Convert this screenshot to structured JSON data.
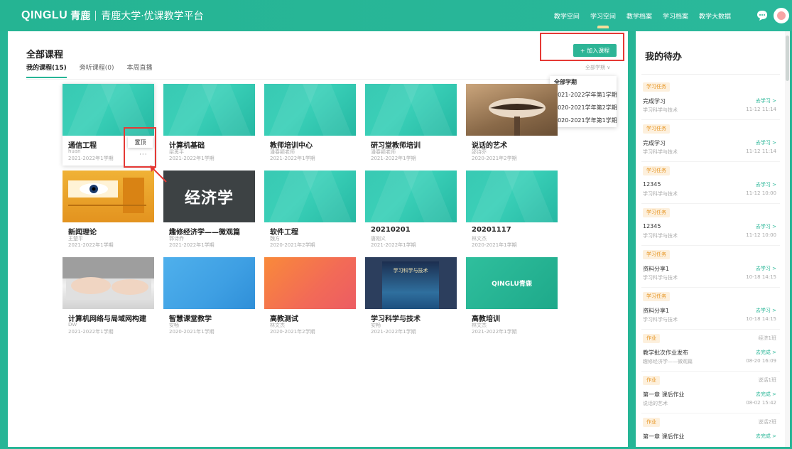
{
  "header": {
    "logo_en": "QINGLU",
    "logo_cn": "青鹿",
    "platform": "青鹿大学·优课教学平台",
    "nav": [
      "教学空间",
      "学习空间",
      "教学档案",
      "学习档案",
      "教学大数据"
    ],
    "active_nav": "学习空间"
  },
  "main": {
    "title": "全部课程",
    "tabs": [
      "我的课程(15)",
      "旁听课程(0)",
      "本周直播"
    ],
    "join_button": "+ 加入课程",
    "term_select": "全部学期 ∨",
    "term_options": [
      "全部学期",
      "2021-2022学年第1学期",
      "2020-2021学年第2学期",
      "2020-2021学年第1学期"
    ],
    "pin_label": "置顶",
    "more_label": "···",
    "courses": [
      {
        "title": "通信工程",
        "teacher": "huan",
        "term": "2021-2022年1学期",
        "cover": "teal"
      },
      {
        "title": "计算机基础",
        "teacher": "梁苒平",
        "term": "2021-2022年1学期",
        "cover": "teal"
      },
      {
        "title": "教师培训中心",
        "teacher": "潘春颖老师",
        "term": "2021-2022年1学期",
        "cover": "teal"
      },
      {
        "title": "研习堂教师培训",
        "teacher": "潘春颖老师",
        "term": "2021-2022年1学期",
        "cover": "teal"
      },
      {
        "title": "说话的艺术",
        "teacher": "邵诗乔",
        "term": "2020-2021年2学期",
        "cover": "lips"
      },
      {
        "title": "新闻理论",
        "teacher": "王楚平",
        "term": "2021-2022年1学期",
        "cover": "news"
      },
      {
        "title": "趣修经济学——微观篇",
        "teacher": "郭诗乔",
        "term": "2021-2022年1学期",
        "cover": "econ",
        "cover_text": "经济学"
      },
      {
        "title": "软件工程",
        "teacher": "魏方",
        "term": "2020-2021年2学期",
        "cover": "teal"
      },
      {
        "title": "20210201",
        "teacher": "唐刚义",
        "term": "2021-2022年1学期",
        "cover": "teal"
      },
      {
        "title": "20201117",
        "teacher": "林文杰",
        "term": "2020-2021年1学期",
        "cover": "teal"
      },
      {
        "title": "计算机网络与局域网构建",
        "teacher": "DW",
        "term": "2021-2022年1学期",
        "cover": "hands"
      },
      {
        "title": "智慧课堂教学",
        "teacher": "安畅",
        "term": "2020-2021年1学期",
        "cover": "blue"
      },
      {
        "title": "高教测试",
        "teacher": "林文杰",
        "term": "2020-2021年2学期",
        "cover": "orange"
      },
      {
        "title": "学习科学与技术",
        "teacher": "安畅",
        "term": "2021-2022年1学期",
        "cover": "book",
        "cover_text": "学习科学与技术"
      },
      {
        "title": "高教培训",
        "teacher": "林文杰",
        "term": "2021-2022年1学期",
        "cover": "brand",
        "cover_text": "QINGLU青鹿"
      }
    ]
  },
  "todo": {
    "title": "我的待办",
    "items": [
      {
        "badge": "学习任务",
        "right": "",
        "name": "完成学习",
        "action": "去学习 >",
        "sub": "学习科学与技术",
        "time": "11-12 11:14"
      },
      {
        "badge": "学习任务",
        "right": "",
        "name": "完成学习",
        "action": "去学习 >",
        "sub": "学习科学与技术",
        "time": "11-12 11:14"
      },
      {
        "badge": "学习任务",
        "right": "",
        "name": "12345",
        "action": "去学习 >",
        "sub": "学习科学与技术",
        "time": "11-12 10:00"
      },
      {
        "badge": "学习任务",
        "right": "",
        "name": "12345",
        "action": "去学习 >",
        "sub": "学习科学与技术",
        "time": "11-12 10:00"
      },
      {
        "badge": "学习任务",
        "right": "",
        "name": "资料分享1",
        "action": "去学习 >",
        "sub": "学习科学与技术",
        "time": "10-18 14:15"
      },
      {
        "badge": "学习任务",
        "right": "",
        "name": "资料分享1",
        "action": "去学习 >",
        "sub": "学习科学与技术",
        "time": "10-18 14:15"
      },
      {
        "badge": "作业",
        "right": "经济1班",
        "name": "教学批次作业发布",
        "action": "去完成 >",
        "sub": "趣修经济学——微观篇",
        "time": "08-20 16:09"
      },
      {
        "badge": "作业",
        "right": "说话1班",
        "name": "第一章 课后作业",
        "action": "去完成 >",
        "sub": "说话的艺术",
        "time": "08-02 15:42"
      },
      {
        "badge": "作业",
        "right": "说话2班",
        "name": "第一章 课后作业",
        "action": "去完成 >",
        "sub": "",
        "time": ""
      }
    ]
  },
  "colors": {
    "brand": "#26b596",
    "badge_bg": "#fdf0dd",
    "badge_text": "#e69421",
    "highlight": "#e53935"
  }
}
